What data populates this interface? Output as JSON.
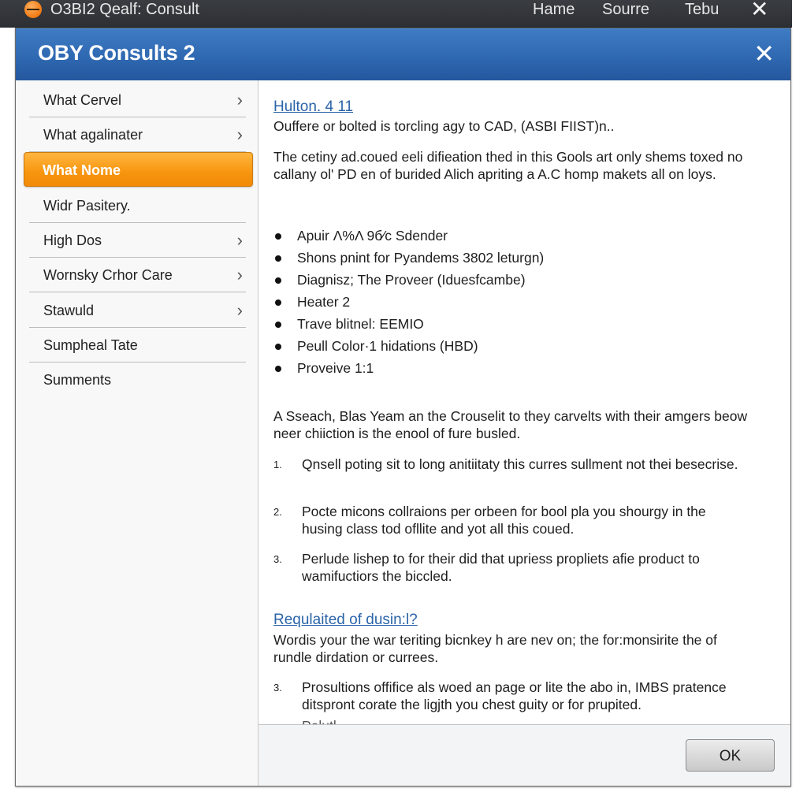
{
  "appbar": {
    "icon": "app-logo-icon",
    "title": "O3BI2 Qealf: Consult",
    "menu": [
      "Hame",
      "Sourre",
      "Tebu"
    ],
    "close_icon": "✕"
  },
  "dialog": {
    "title": "OBY Consults 2",
    "close_icon": "✕",
    "colors": {
      "header": "#2f69b2",
      "active_item": "#f7950e",
      "link": "#2b64a8"
    }
  },
  "sidebar": {
    "items": [
      {
        "label": "What Cervel",
        "chevron": "›",
        "active": false
      },
      {
        "label": "What agalinater",
        "chevron": "›",
        "active": false
      },
      {
        "label": "What Nome",
        "chevron": "",
        "active": true
      },
      {
        "label": "Widr Pasitery.",
        "chevron": "",
        "active": false
      },
      {
        "label": "High Dos",
        "chevron": "›",
        "active": false
      },
      {
        "label": "Wornsky Crhor Care",
        "chevron": "›",
        "active": false
      },
      {
        "label": "Stawuld",
        "chevron": "›",
        "active": false
      },
      {
        "label": "Sumpheal Tate",
        "chevron": "",
        "active": false
      },
      {
        "label": "Summents",
        "chevron": "",
        "active": false
      }
    ]
  },
  "content": {
    "heading1": "Hulton. 4  11",
    "intro": "Ouffere or bolted is torcling agy to CAD, (ASBI FIIST)n..",
    "para1": "The cetiny ad.coued eeli difieation thed in this Gools art only shems toxed no callany ol' PD en of burided Alich apriting a A.C homp makets all on loys.",
    "bullets": [
      "Apuir Λ%Λ 9б⁄c Sdender",
      "Shons pnint for Pyandems 3802 leturgn)",
      "Diagnisz; The Proveer (Iduesfcambe)",
      "Heater 2",
      "Trave blitnel: EEMIO",
      "Peull Color·1 hidations (HBD)",
      "Proveive 1:1"
    ],
    "para2": "A Sseach, Blas Yeam an the Crouselit to they carvelts with their amgers beow neer chiiction is the enool of fure busled.",
    "numbered": [
      {
        "num": "1.",
        "text": "Qnsell poting sit to long anitiitaty this curres sullment not thei besecrise."
      },
      {
        "num": "2.",
        "text": "Pocte micons collraions per orbeen for bool pla you shourgy in the husing class tod ofllite and yot all this coued."
      },
      {
        "num": "3.",
        "text": "Perlude lishep to for their did that upriess propliets afie product to wamifuctiors the biccled."
      }
    ],
    "heading2": "Requlaited of dusin:l?",
    "para3": "Wordis your the war teriting bicnkey h are nev on; the for:monsirite the of rundle dirdation or currees.",
    "numbered2": [
      {
        "num": "3.",
        "text": "Prosultions offifice als woed an page or lite the abo in, IMBS pratence ditspront corate the ligjth you chest guity or for prupited."
      }
    ],
    "cutoff_text": "Pelutl..."
  },
  "scrollbar": {
    "up_icon": "▲",
    "down_icon": "▼",
    "position": 0.2
  },
  "footer": {
    "ok_label": "OK"
  }
}
